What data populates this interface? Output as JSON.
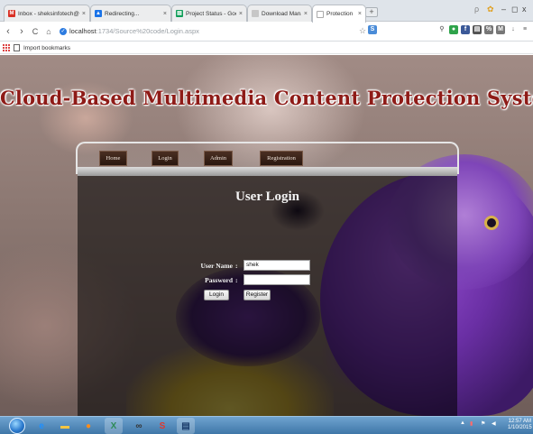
{
  "browser": {
    "tabs": [
      {
        "title": "Inbox - sheksinfotech@",
        "favicon": "gmail-icon",
        "color": "#d93025",
        "glyph": "M"
      },
      {
        "title": "Redirecting...",
        "favicon": "drive-icon",
        "color": "#1a73e8",
        "glyph": "▲"
      },
      {
        "title": "Project Status - Google Sh",
        "favicon": "sheets-icon",
        "color": "#0f9d58",
        "glyph": "▤"
      },
      {
        "title": "Download Manager",
        "favicon": "download-icon",
        "color": "#c7c7c7",
        "glyph": ""
      },
      {
        "title": "Protection",
        "favicon": "page-icon",
        "color": "#ffffff",
        "glyph": ""
      }
    ],
    "url_host": "localhost",
    "url_path": ":1734/Source%20code/Login.aspx",
    "bookmarks_label": "Import bookmarks"
  },
  "page": {
    "site_title": "Cloud-Based Multimedia Content Protection System",
    "menu": [
      "Home",
      "Login",
      "Admin",
      "Registration"
    ],
    "login_title": "User Login",
    "form": {
      "username_label": "User Name",
      "username_value": "shek",
      "password_label": "Password",
      "password_value": "",
      "colon": ":",
      "login_button": "Login",
      "register_button": "Register"
    }
  },
  "taskbar": {
    "time": "12:57 AM",
    "date": "1/10/2015"
  },
  "colors": {
    "title_red": "#8e1b17",
    "menu_brown": "#3a2216",
    "taskbar_blue": "#4f86b8"
  }
}
